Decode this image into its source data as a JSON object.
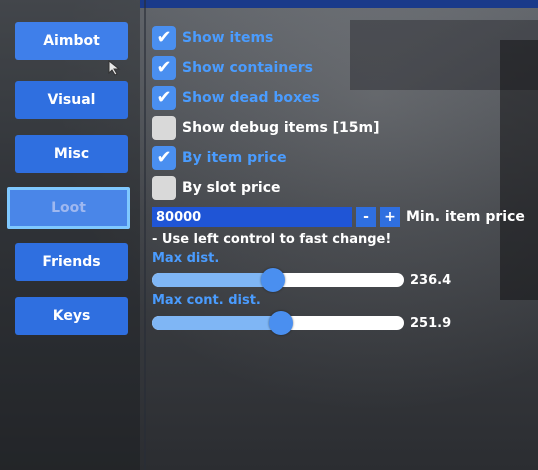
{
  "sidebar": {
    "items": [
      {
        "label": "Aimbot"
      },
      {
        "label": "Visual"
      },
      {
        "label": "Misc"
      },
      {
        "label": "Loot"
      },
      {
        "label": "Friends"
      },
      {
        "label": "Keys"
      }
    ],
    "selected": "Loot"
  },
  "options": [
    {
      "label": "Show items",
      "checked": true
    },
    {
      "label": "Show containers",
      "checked": true
    },
    {
      "label": "Show dead boxes",
      "checked": true
    },
    {
      "label": "Show debug items [15m]",
      "checked": false
    },
    {
      "label": "By item price",
      "checked": true
    },
    {
      "label": "By slot price",
      "checked": false
    }
  ],
  "price": {
    "value": "80000",
    "minus_label": "-",
    "plus_label": "+",
    "label": "Min. item price"
  },
  "hint": "- Use left control to fast change!",
  "sliders": [
    {
      "label": "Max dist.",
      "value_text": "236.4",
      "fraction": 0.48
    },
    {
      "label": "Max cont. dist.",
      "value_text": "251.9",
      "fraction": 0.51
    }
  ],
  "colors": {
    "accent": "#2f6fe0",
    "checked_text": "#4a9cff",
    "selected_border": "#7fc8ff"
  },
  "icons": {
    "check": "check-icon",
    "cursor": "cursor-icon"
  }
}
